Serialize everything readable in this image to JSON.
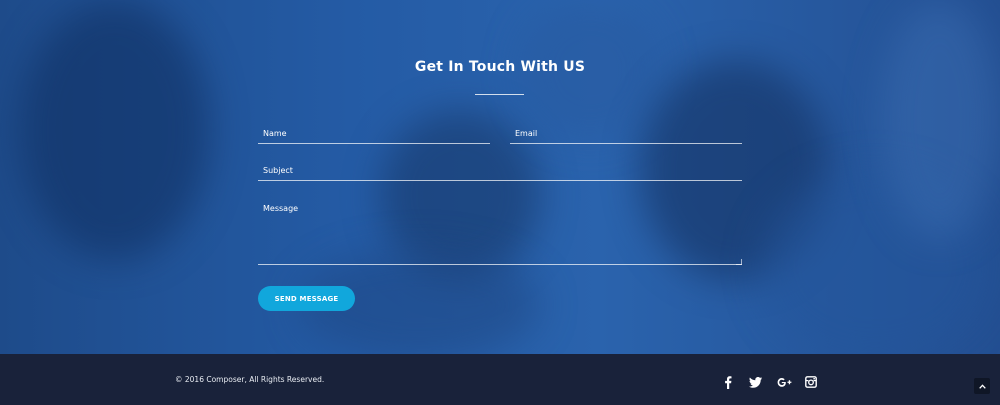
{
  "contact": {
    "title": "Get In Touch With US",
    "fields": {
      "name_placeholder": "Name",
      "email_placeholder": "Email",
      "subject_placeholder": "Subject",
      "message_placeholder": "Message"
    },
    "send_label": "SEND MESSAGE"
  },
  "footer": {
    "copyright": "© 2016 Composer, All Rights Reserved.",
    "social": [
      "facebook-icon",
      "twitter-icon",
      "google-plus-icon",
      "instagram-icon"
    ]
  },
  "colors": {
    "accent": "#11a7dc",
    "footer_bg": "#19223a",
    "overlay": "#245ba5"
  }
}
